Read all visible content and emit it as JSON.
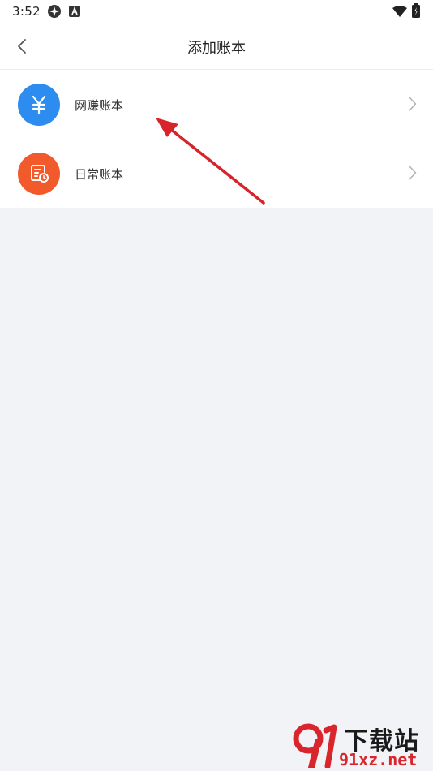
{
  "status_bar": {
    "time": "3:52"
  },
  "nav": {
    "title": "添加账本"
  },
  "items": [
    {
      "label": "网赚账本",
      "icon": "yen-icon",
      "color": "#2d8cf0"
    },
    {
      "label": "日常账本",
      "icon": "ledger-clock-icon",
      "color": "#f25a2c"
    }
  ],
  "watermark": {
    "logo_text": "下载站",
    "url": "91xz.net",
    "brand_number": "91",
    "accent": "#d9262c"
  },
  "colors": {
    "background": "#f2f3f7",
    "annotation_arrow": "#d8232a"
  }
}
